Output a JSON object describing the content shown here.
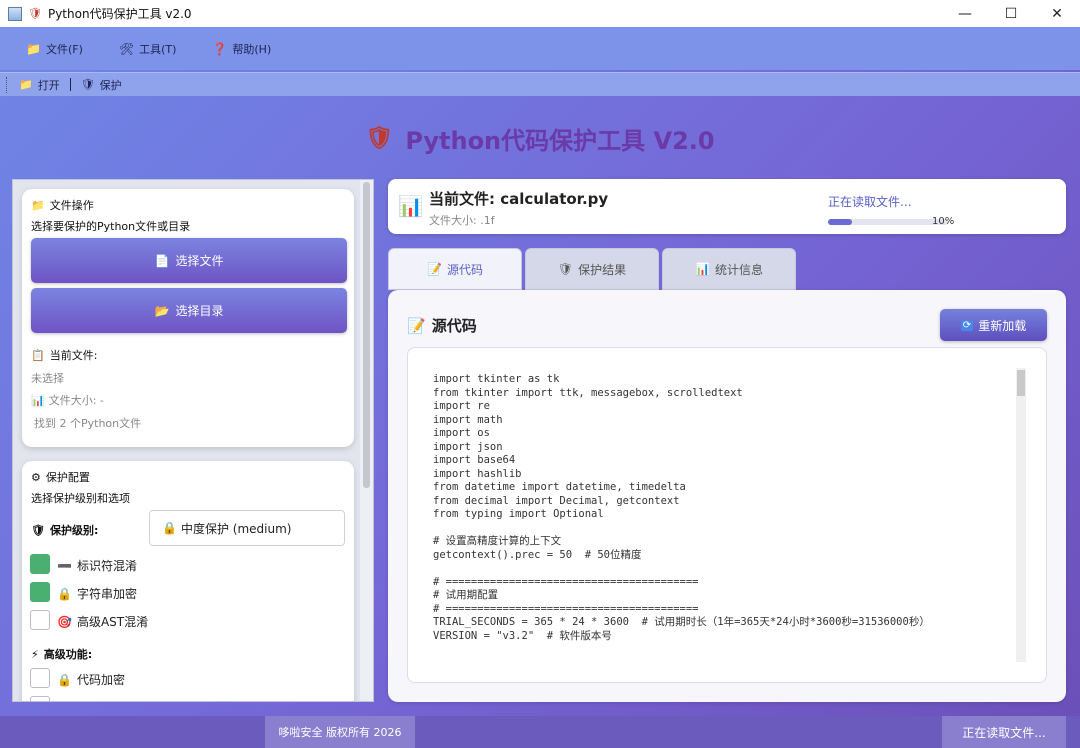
{
  "window": {
    "title": "Python代码保护工具 v2.0",
    "minimize_icon": "—",
    "maximize_icon": "☐",
    "close_icon": "✕"
  },
  "menu": [
    {
      "label": "文件(F)",
      "icon": "📁"
    },
    {
      "label": "工具(T)",
      "icon": "🛠"
    },
    {
      "label": "帮助(H)",
      "icon": "❓"
    }
  ],
  "toolbar": {
    "open_label": "打开",
    "protect_label": "保护"
  },
  "app_title": "Python代码保护工具 V2.0",
  "file_ops": {
    "heading": "文件操作",
    "subtitle": "选择要保护的Python文件或目录",
    "select_file": "选择文件",
    "select_dir": "选择目录",
    "current_file_label": "当前文件:",
    "current_file_value": "未选择",
    "file_size": "文件大小: -",
    "found_files": "找到 2 个Python文件"
  },
  "protect_config": {
    "heading": "保护配置",
    "subtitle": "选择保护级别和选项",
    "level_label": "保护级别:",
    "level_value": "中度保护 (medium)",
    "options": [
      {
        "label": "标识符混淆",
        "checked": true,
        "icon": "➖"
      },
      {
        "label": "字符串加密",
        "checked": true,
        "icon": "🔒"
      },
      {
        "label": "高级AST混淆",
        "checked": false,
        "icon": "🎯"
      }
    ],
    "advanced_label": "高级功能:",
    "advanced_options": [
      {
        "label": "代码加密",
        "checked": false,
        "icon": "🔒"
      }
    ]
  },
  "current_file": {
    "name": "当前文件: calculator.py",
    "size": "文件大小: .1f",
    "status": "正在读取文件...",
    "progress_percent": 10,
    "progress_text": "10%"
  },
  "tabs": [
    {
      "label": "源代码",
      "icon": "📝",
      "active": true
    },
    {
      "label": "保护结果",
      "icon": "🛡",
      "active": false
    },
    {
      "label": "统计信息",
      "icon": "📊",
      "active": false
    }
  ],
  "source_panel": {
    "heading": "源代码",
    "reload": "重新加载",
    "code_lines": [
      "import tkinter as tk",
      "from tkinter import ttk, messagebox, scrolledtext",
      "import re",
      "import math",
      "import os",
      "import json",
      "import base64",
      "import hashlib",
      "from datetime import datetime, timedelta",
      "from decimal import Decimal, getcontext",
      "from typing import Optional",
      "",
      "# 设置高精度计算的上下文",
      "getcontext().prec = 50  # 50位精度",
      "",
      "# ========================================",
      "# 试用期配置",
      "# ========================================",
      "TRIAL_SECONDS = 365 * 24 * 3600  # 试用期时长（1年=365天*24小时*3600秒=31536000秒）",
      "VERSION = \"v3.2\"  # 软件版本号"
    ]
  },
  "statusbar": {
    "copyright": "哆啦安全 版权所有 2026",
    "status": "正在读取文件..."
  }
}
